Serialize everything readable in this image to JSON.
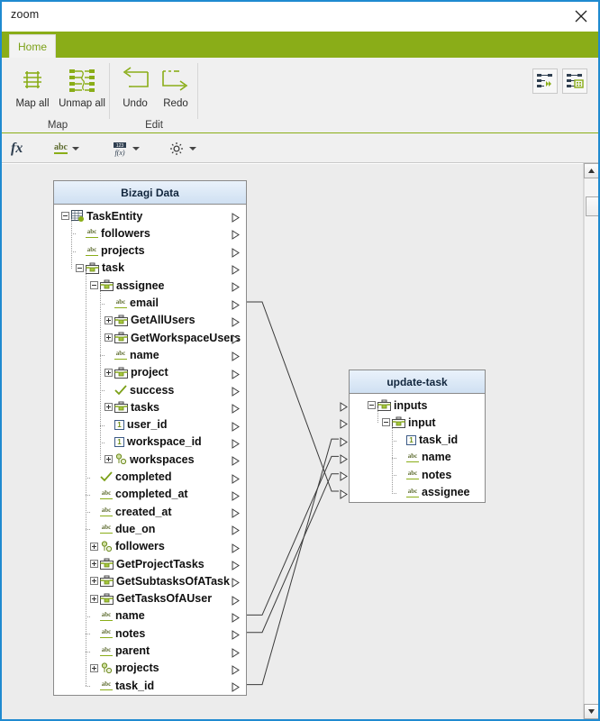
{
  "window": {
    "title": "zoom",
    "close_icon": "close-icon"
  },
  "ribbon": {
    "tabs": [
      {
        "label": "Home"
      }
    ],
    "groups": [
      {
        "label": "Map",
        "buttons": [
          {
            "label": "Map all",
            "icon": "map-all-icon"
          },
          {
            "label": "Unmap all",
            "icon": "unmap-all-icon"
          }
        ]
      },
      {
        "label": "Edit",
        "buttons": [
          {
            "label": "Undo",
            "icon": "undo-arrow-icon"
          },
          {
            "label": "Redo",
            "icon": "redo-arrow-icon"
          }
        ]
      }
    ],
    "quick_buttons": [
      {
        "name": "auto-map-icon"
      },
      {
        "name": "map-properties-icon"
      }
    ]
  },
  "fxbar": {
    "items": [
      {
        "name": "function-icon",
        "glyph": "fx"
      },
      {
        "name": "string-transform-icon",
        "glyph": "abc",
        "has_caret": true
      },
      {
        "name": "number-transform-icon",
        "glyph": "123",
        "has_caret": true
      },
      {
        "name": "settings-gear-icon",
        "glyph": "gear",
        "has_caret": true
      }
    ]
  },
  "canvas": {
    "source_panel": {
      "title": "Bizagi Data",
      "rows": [
        {
          "label": "TaskEntity",
          "depth": 0,
          "icon": "entity-icon",
          "expander": "minus",
          "port": true
        },
        {
          "label": "followers",
          "depth": 1,
          "icon": "string-icon",
          "expander": "none",
          "port": true
        },
        {
          "label": "projects",
          "depth": 1,
          "icon": "string-icon",
          "expander": "none",
          "port": true
        },
        {
          "label": "task",
          "depth": 1,
          "icon": "object-icon",
          "expander": "minus",
          "port": true
        },
        {
          "label": "assignee",
          "depth": 2,
          "icon": "object-icon",
          "expander": "minus",
          "port": true
        },
        {
          "label": "email",
          "depth": 3,
          "icon": "string-icon",
          "expander": "none",
          "port": true,
          "mapped": true
        },
        {
          "label": "GetAllUsers",
          "depth": 3,
          "icon": "object-icon",
          "expander": "plus",
          "port": true
        },
        {
          "label": "GetWorkspaceUsers",
          "depth": 3,
          "icon": "object-icon",
          "expander": "plus",
          "port": true
        },
        {
          "label": "name",
          "depth": 3,
          "icon": "string-icon",
          "expander": "none",
          "port": true
        },
        {
          "label": "project",
          "depth": 3,
          "icon": "object-icon",
          "expander": "plus",
          "port": true
        },
        {
          "label": "success",
          "depth": 3,
          "icon": "boolean-icon",
          "expander": "none",
          "port": true
        },
        {
          "label": "tasks",
          "depth": 3,
          "icon": "object-icon",
          "expander": "plus",
          "port": true
        },
        {
          "label": "user_id",
          "depth": 3,
          "icon": "number-icon",
          "expander": "none",
          "port": true
        },
        {
          "label": "workspace_id",
          "depth": 3,
          "icon": "number-icon",
          "expander": "none",
          "port": true
        },
        {
          "label": "workspaces",
          "depth": 3,
          "icon": "collection-icon",
          "expander": "plus",
          "port": true
        },
        {
          "label": "completed",
          "depth": 2,
          "icon": "boolean-icon",
          "expander": "none",
          "port": true
        },
        {
          "label": "completed_at",
          "depth": 2,
          "icon": "string-icon",
          "expander": "none",
          "port": true
        },
        {
          "label": "created_at",
          "depth": 2,
          "icon": "string-icon",
          "expander": "none",
          "port": true
        },
        {
          "label": "due_on",
          "depth": 2,
          "icon": "string-icon",
          "expander": "none",
          "port": true
        },
        {
          "label": "followers",
          "depth": 2,
          "icon": "collection-icon",
          "expander": "plus",
          "port": true
        },
        {
          "label": "GetProjectTasks",
          "depth": 2,
          "icon": "object-icon",
          "expander": "plus",
          "port": true
        },
        {
          "label": "GetSubtasksOfATask",
          "depth": 2,
          "icon": "object-icon",
          "expander": "plus",
          "port": true
        },
        {
          "label": "GetTasksOfAUser",
          "depth": 2,
          "icon": "object-icon",
          "expander": "plus",
          "port": true
        },
        {
          "label": "name",
          "depth": 2,
          "icon": "string-icon",
          "expander": "none",
          "port": true,
          "mapped": true
        },
        {
          "label": "notes",
          "depth": 2,
          "icon": "string-icon",
          "expander": "none",
          "port": true,
          "mapped": true
        },
        {
          "label": "parent",
          "depth": 2,
          "icon": "string-icon",
          "expander": "none",
          "port": true
        },
        {
          "label": "projects",
          "depth": 2,
          "icon": "collection-icon",
          "expander": "plus",
          "port": true
        },
        {
          "label": "task_id",
          "depth": 2,
          "icon": "string-icon",
          "expander": "none",
          "port": true,
          "mapped": true
        }
      ]
    },
    "target_panel": {
      "title": "update-task",
      "rows": [
        {
          "label": "inputs",
          "depth": 0,
          "icon": "object-icon",
          "expander": "minus",
          "port": true
        },
        {
          "label": "input",
          "depth": 1,
          "icon": "object-icon",
          "expander": "minus",
          "port": true
        },
        {
          "label": "task_id",
          "depth": 2,
          "icon": "number-icon",
          "expander": "none",
          "port": true,
          "mapped": true
        },
        {
          "label": "name",
          "depth": 2,
          "icon": "string-icon",
          "expander": "none",
          "port": true,
          "mapped": true
        },
        {
          "label": "notes",
          "depth": 2,
          "icon": "string-icon",
          "expander": "none",
          "port": true,
          "mapped": true
        },
        {
          "label": "assignee",
          "depth": 2,
          "icon": "string-icon",
          "expander": "none",
          "port": true,
          "mapped": true
        }
      ]
    },
    "connections": [
      {
        "from": "email",
        "to": "assignee"
      },
      {
        "from": "name",
        "to": "name"
      },
      {
        "from": "notes",
        "to": "notes"
      },
      {
        "from": "task_id",
        "to": "task_id"
      }
    ]
  },
  "colors": {
    "brand_green": "#8aad18",
    "window_border": "#1f8ad0",
    "panel_header": "#cfe0f2",
    "ribbon_bg": "#f0f0f0",
    "canvas_bg": "#ececec"
  }
}
